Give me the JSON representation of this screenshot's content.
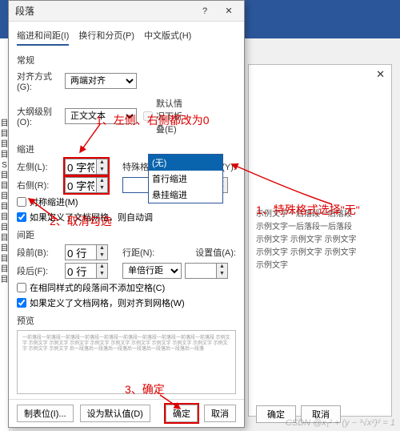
{
  "window": {
    "title": "段落",
    "help": "?",
    "close": "✕"
  },
  "tabs": {
    "t1": "缩进和间距(I)",
    "t2": "换行和分页(P)",
    "t3": "中文版式(H)"
  },
  "general": {
    "label": "常规",
    "align_label": "对齐方式(G):",
    "align_value": "两端对齐",
    "outline_label": "大纲级别(O):",
    "outline_value": "正文文本",
    "collapse": "默认情况下折叠(E)"
  },
  "indent": {
    "label": "缩进",
    "left_label": "左侧(L):",
    "left_value": "0 字符",
    "right_label": "右侧(R):",
    "right_value": "0 字符",
    "special_label": "特殊格式(S):",
    "by_label": "缩进值(Y):",
    "mirror": "对称缩进(M)",
    "grid": "如果定义了文档网格，则自动调",
    "dropdown": {
      "o1": "(无)",
      "o2": "首行缩进",
      "o3": "悬挂缩进"
    }
  },
  "spacing": {
    "label": "间距",
    "before_label": "段前(B):",
    "before_value": "0 行",
    "after_label": "段后(F):",
    "after_value": "0 行",
    "line_label": "行距(N):",
    "line_value": "单倍行距",
    "at_label": "设置值(A):",
    "nospace": "在相同样式的段落间不添加空格(C)",
    "grid": "如果定义了文档网格，则对齐到网格(W)"
  },
  "preview": {
    "label": "预览",
    "text": "一前落段一前落段一前落段一前落段一前落段一前落段一前落段一前落段一前落段一前落段 示例文字 示例文字 示例文字 示例文字 示例文字 示例文字 示例文字 示例文字 示例文字 示例文字 示例文字 示例文字 示例文字 后一段落后一段落后一段落后一段落后一段落后一段落后一段落"
  },
  "footer": {
    "tabs": "制表位(I)...",
    "default": "设为默认值(D)",
    "ok": "确定",
    "cancel": "取消"
  },
  "bg": {
    "l1": "示例文字一后落段一后落段",
    "l2": "示例文字一后落段一后落段",
    "l3": "示例文字 示例文字 示例文字",
    "l4": "示例文字 示例文字 示例文字",
    "l5": "示例文字",
    "ok": "确定",
    "cancel": "取消"
  },
  "anno": {
    "a1": "1、左侧、右侧都改为0",
    "a2": "2、取消勾选",
    "a3": "1、特殊格式选择\"无\"",
    "a4": "3、确定"
  },
  "leftcol": "目目目目S目目目目目目目目目目目",
  "watermark": "CSDN @x₁² + (y − ³√x²)² = 1"
}
